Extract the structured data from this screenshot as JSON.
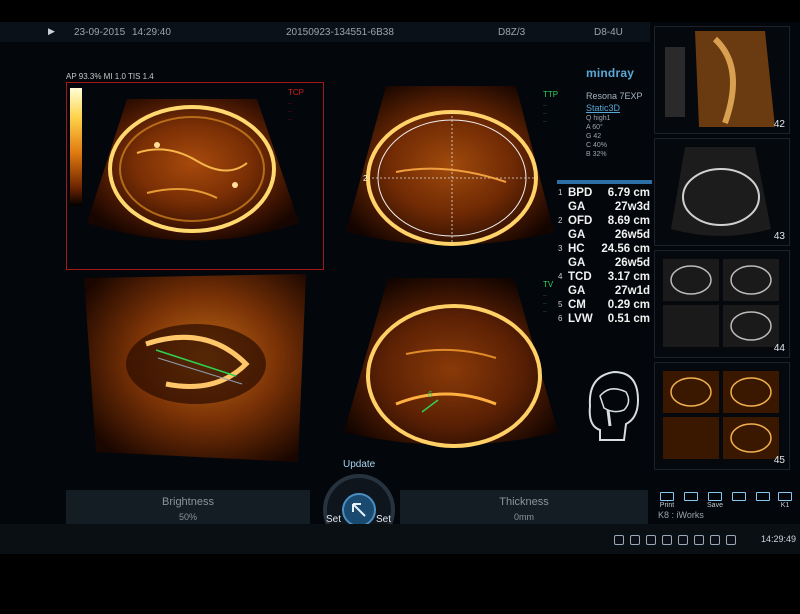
{
  "header": {
    "date": "23-09-2015",
    "time": "14:29:40",
    "exam_id": "20150923-134551-6B38",
    "probe": "D8Z/3",
    "preset": "D8-4U"
  },
  "image_params": "AP 93.3%  MI 1.0  TIS 1.4",
  "quadrants": {
    "q1": {
      "label": "TCP"
    },
    "q2": {
      "label": "TTP",
      "marker": "2"
    },
    "q3": {
      "label": ""
    },
    "q4": {
      "label": "TV",
      "marker": "6"
    }
  },
  "side_info": {
    "brand": "mindray",
    "model": "Resona 7EXP",
    "mode": "Static3D",
    "quality": "Q high1",
    "angle": "A 60°",
    "gain": "G 42",
    "contrast": "C 40%",
    "b": "B 32%"
  },
  "measurements": [
    {
      "num": "1",
      "label": "BPD",
      "value": "6.79 cm"
    },
    {
      "num": "",
      "label": "GA",
      "value": "27w3d"
    },
    {
      "num": "2",
      "label": "OFD",
      "value": "8.69 cm"
    },
    {
      "num": "",
      "label": "GA",
      "value": "26w5d"
    },
    {
      "num": "3",
      "label": "HC",
      "value": "24.56 cm"
    },
    {
      "num": "",
      "label": "GA",
      "value": "26w5d"
    },
    {
      "num": "4",
      "label": "TCD",
      "value": "3.17 cm"
    },
    {
      "num": "",
      "label": "GA",
      "value": "27w1d"
    },
    {
      "num": "5",
      "label": "CM",
      "value": "0.29 cm"
    },
    {
      "num": "6",
      "label": "LVW",
      "value": "0.51 cm"
    }
  ],
  "thumbnails": [
    {
      "number": "42",
      "style": "orange-3d"
    },
    {
      "number": "43",
      "style": "gray-2d"
    },
    {
      "number": "44",
      "style": "gray-quad"
    },
    {
      "number": "45",
      "style": "orange-quad"
    }
  ],
  "controls": {
    "brightness": {
      "title": "Brightness",
      "value": "50%"
    },
    "thickness": {
      "title": "Thickness",
      "value": "0mm"
    },
    "dial": {
      "update": "Update",
      "set_left": "Set",
      "set_right": "Set"
    }
  },
  "tools": [
    {
      "label": "Print"
    },
    {
      "label": ""
    },
    {
      "label": "Save"
    },
    {
      "label": ""
    },
    {
      "label": ""
    },
    {
      "label": "K1"
    }
  ],
  "kb_label": "K8 : iWorks",
  "taskbar_time": "14:29:49",
  "colors": {
    "accent_blue": "#5aa8d6",
    "roi_red": "#a01818",
    "label_green": "#2fd05c",
    "measure_text": "#f1f1f1"
  }
}
